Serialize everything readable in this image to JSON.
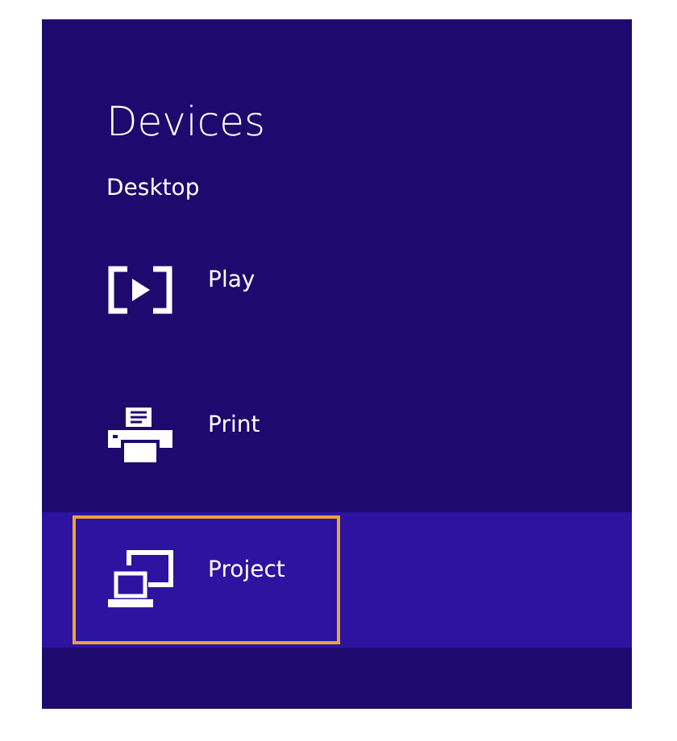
{
  "title": "Devices",
  "section": "Desktop",
  "items": [
    {
      "label": "Play",
      "kind": "play",
      "selected": false
    },
    {
      "label": "Print",
      "kind": "print",
      "selected": false
    },
    {
      "label": "Project",
      "kind": "project",
      "selected": true
    }
  ]
}
